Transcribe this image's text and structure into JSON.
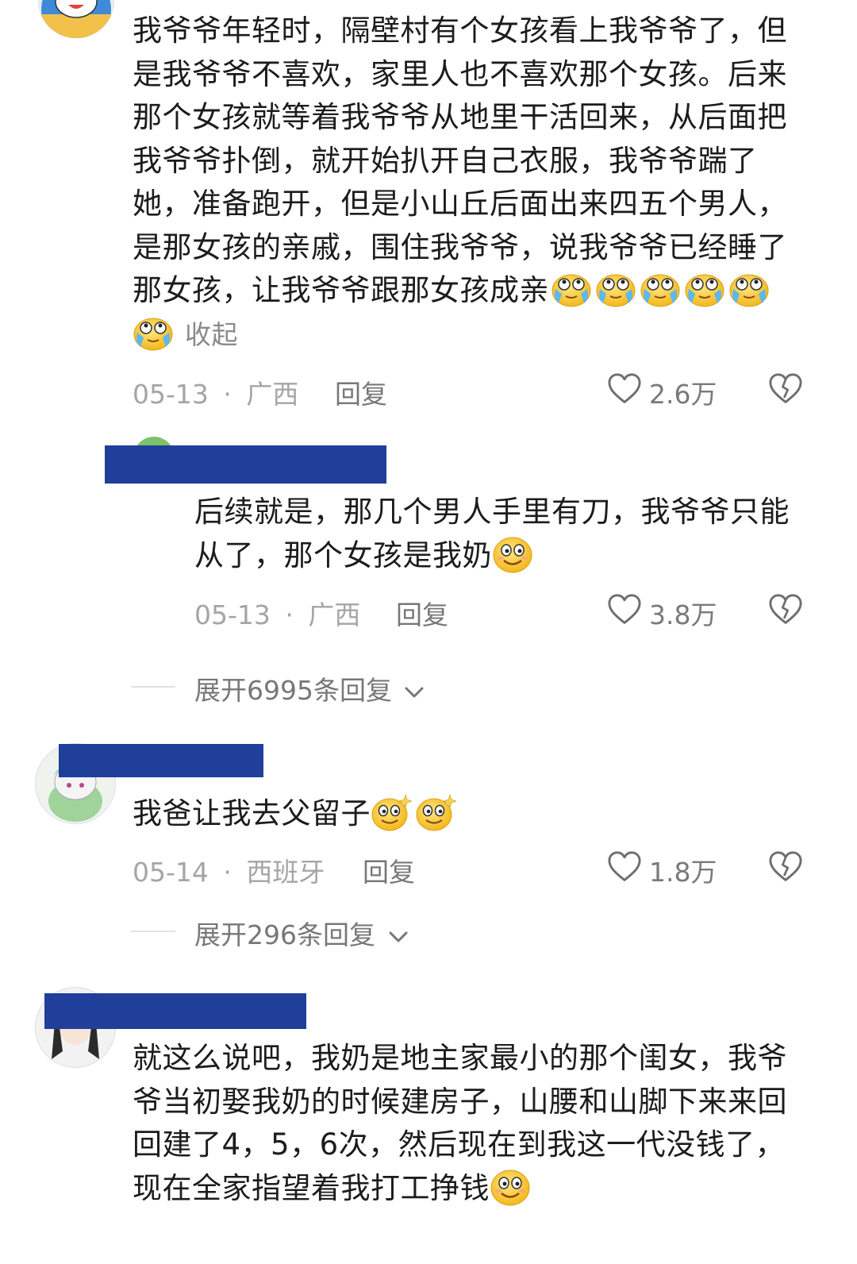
{
  "comments": [
    {
      "text": "我爷爷年轻时，隔壁村有个女孩看上我爷爷了，但是我爷爷不喜欢，家里人也不喜欢那个女孩。后来那个女孩就等着我爷爷从地里干活回来，从后面把我爷爷扑倒，就开始扒开自己衣服，我爷爷踹了她，准备跑开，但是小山丘后面出来四五个男人，是那女孩的亲戚，围住我爷爷，说我爷爷已经睡了那女孩，让我爷爷跟那女孩成亲",
      "collapse_label": "收起",
      "date": "05-13",
      "location": "广西",
      "reply_label": "回复",
      "likes": "2.6万"
    },
    {
      "text": "后续就是，那几个男人手里有刀，我爷爷只能从了，那个女孩是我奶",
      "date": "05-13",
      "location": "广西",
      "reply_label": "回复",
      "likes": "3.8万"
    },
    {
      "text": "我爸让我去父留子",
      "date": "05-14",
      "location": "西班牙",
      "reply_label": "回复",
      "likes": "1.8万"
    },
    {
      "text": "就这么说吧，我奶是地主家最小的那个闺女，我爷爷当初娶我奶的时候建房子，山腰和山脚下来来回回建了4，5，6次，然后现在到我这一代没钱了，现在全家指望着我打工挣钱"
    }
  ],
  "expand_replies": [
    "展开6995条回复",
    "展开296条回复"
  ],
  "meta_separator": "·",
  "colors": {
    "redaction": "#1f3f9a",
    "meta_text": "#a5a5a5",
    "emoji_yellow": "#f7c72c"
  },
  "icons": {
    "like": "heart-outline-icon",
    "dislike": "broken-heart-icon",
    "expand": "chevron-down-icon"
  }
}
